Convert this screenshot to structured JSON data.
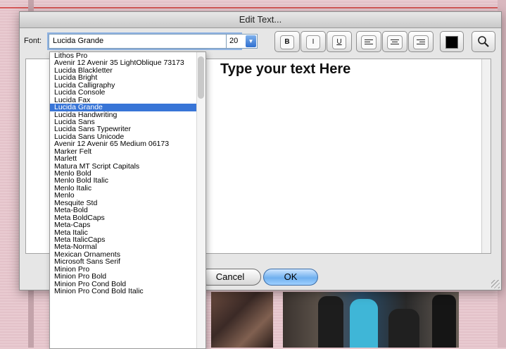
{
  "dialog": {
    "title": "Edit Text...",
    "font_label": "Font:",
    "font_value": "Lucida Grande",
    "size_value": "20",
    "bold_label": "B",
    "italic_label": "I",
    "underline_label": "U",
    "text_color": "#000000",
    "text_content": "Type your text Here",
    "cancel_label": "Cancel",
    "ok_label": "OK"
  },
  "font_list": {
    "selected_index": 7,
    "items": [
      "Lithos Pro",
      "Avenir 12 Avenir 35 LightOblique   73173",
      "Lucida Blackletter",
      "Lucida Bright",
      "Lucida Calligraphy",
      "Lucida Console",
      "Lucida Fax",
      "Lucida Grande",
      "Lucida Handwriting",
      "Lucida Sans",
      "Lucida Sans Typewriter",
      "Lucida Sans Unicode",
      "Avenir 12 Avenir 65 Medium   06173",
      "Marker Felt",
      "Marlett",
      "Matura MT Script Capitals",
      "Menlo Bold",
      "Menlo Bold Italic",
      "Menlo Italic",
      "Menlo",
      "Mesquite Std",
      "Meta-Bold",
      "Meta BoldCaps",
      "Meta-Caps",
      "Meta Italic",
      "Meta ItalicCaps",
      "Meta-Normal",
      "Mexican Ornaments",
      "Microsoft Sans Serif",
      "Minion Pro",
      "Minion Pro Bold",
      "Minion Pro Cond Bold",
      "Minion Pro Cond Bold Italic"
    ]
  },
  "colors": {
    "selection": "#3875d7",
    "ok_button": "#6fb0ef",
    "background_page": "#e8c9cf"
  }
}
